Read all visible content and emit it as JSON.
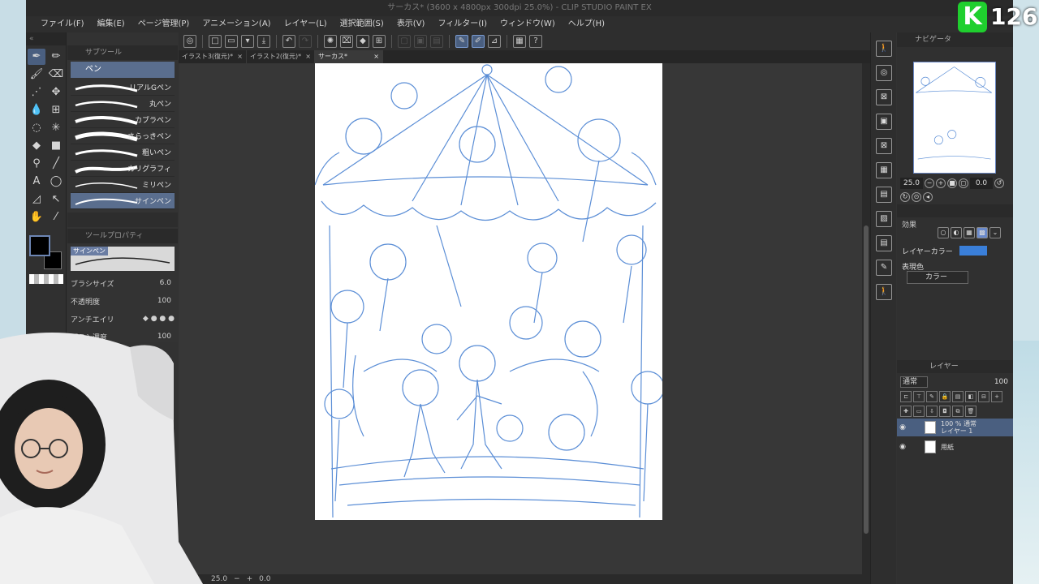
{
  "window": {
    "title": "サーカス* (3600 x 4800px 300dpi 25.0%) - CLIP STUDIO PAINT EX"
  },
  "menu": [
    "ファイル(F)",
    "編集(E)",
    "ページ管理(P)",
    "アニメーション(A)",
    "レイヤー(L)",
    "選択範囲(S)",
    "表示(V)",
    "フィルター(I)",
    "ウィンドウ(W)",
    "ヘルプ(H)"
  ],
  "tabs": [
    {
      "label": "イラスト3(復元)*"
    },
    {
      "label": "イラスト2(復元)*"
    },
    {
      "label": "サーカス*"
    }
  ],
  "subtool": {
    "header": "サブツール",
    "selected": "ペン",
    "brushes": [
      "リアルGペン",
      "丸ペン",
      "カブラペン",
      "さらっきペン",
      "粗いペン",
      "カリグラフィ",
      "ミリペン",
      "サインペン"
    ]
  },
  "toolprop": {
    "header": "ツールプロパティ",
    "preview_tag": "サインペン",
    "brush_size_label": "ブラシサイズ",
    "brush_size": "6.0",
    "opacity_label": "不透明度",
    "opacity": "100",
    "antialias_label": "アンチエイリ",
    "density_label": "ブラシ濃度",
    "density": "100"
  },
  "navigator": {
    "header": "ナビゲータ",
    "zoom": "25.0",
    "angle": "0.0"
  },
  "layer_props": {
    "effect_label": "効果",
    "layer_color_label": "レイヤーカラー",
    "expression_label": "表現色",
    "expression_value": "カラー",
    "layer_color": "#3a7fd9"
  },
  "layers": {
    "header": "レイヤー",
    "blend": "通常",
    "opacity": "100",
    "items": [
      {
        "name_line1": "100 % 通常",
        "name_line2": "レイヤー 1"
      },
      {
        "name_line1": "用紙",
        "name_line2": ""
      }
    ]
  },
  "status": {
    "zoom": "25.0",
    "angle": "0.0"
  },
  "badge": {
    "letter": "K",
    "count": "126",
    "color": "#1fcf2e"
  },
  "sketch_color": "#5b8ed6"
}
